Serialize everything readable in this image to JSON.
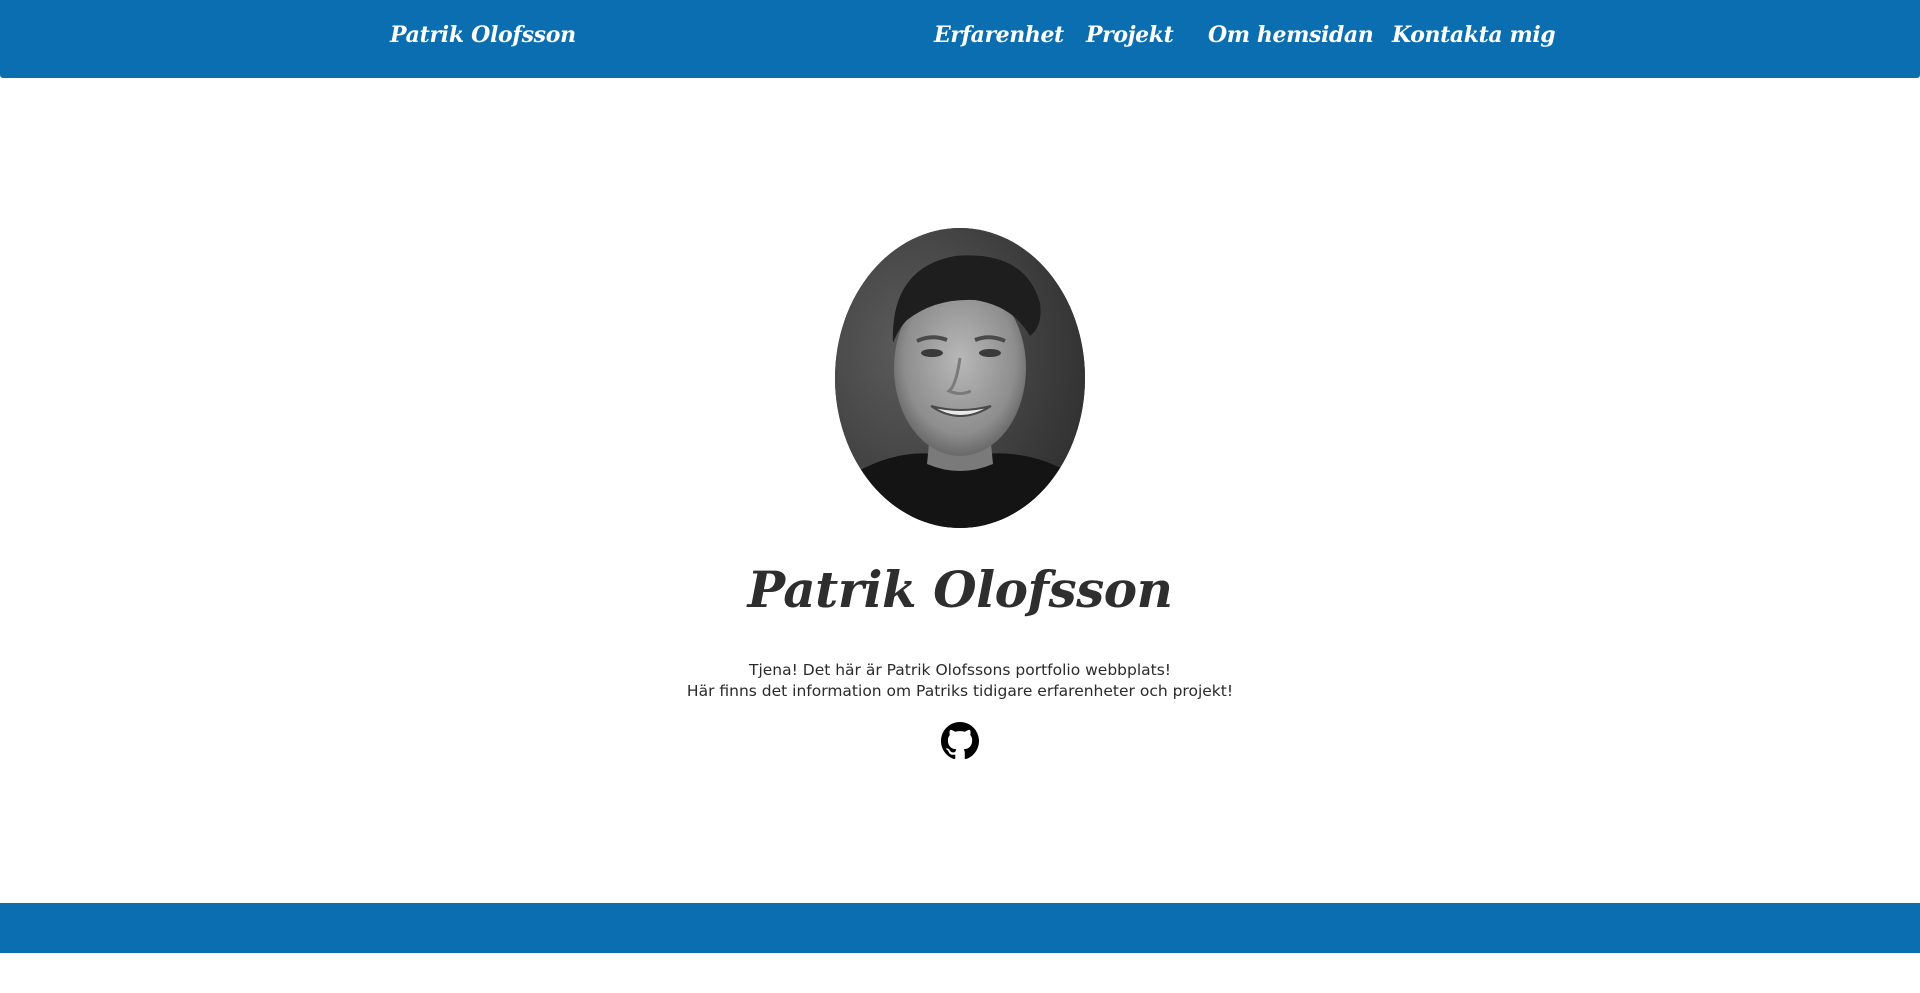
{
  "brand": "Patrik Olofsson",
  "nav": {
    "items": [
      {
        "label": "Erfarenhet"
      },
      {
        "label": "Projekt"
      },
      {
        "label": "Om hemsidan"
      },
      {
        "label": "Kontakta mig"
      }
    ]
  },
  "hero": {
    "name": "Patrik Olofsson",
    "intro_line_1": "Tjena! Det här är Patrik Olofssons portfolio webbplats!",
    "intro_line_2": "Här finns det information om Patriks tidigare erfarenheter och projekt!"
  },
  "icons": {
    "github": "github-icon"
  },
  "colors": {
    "primary": "#0a6eb0",
    "text": "#2e2e2e",
    "background": "#ffffff"
  }
}
